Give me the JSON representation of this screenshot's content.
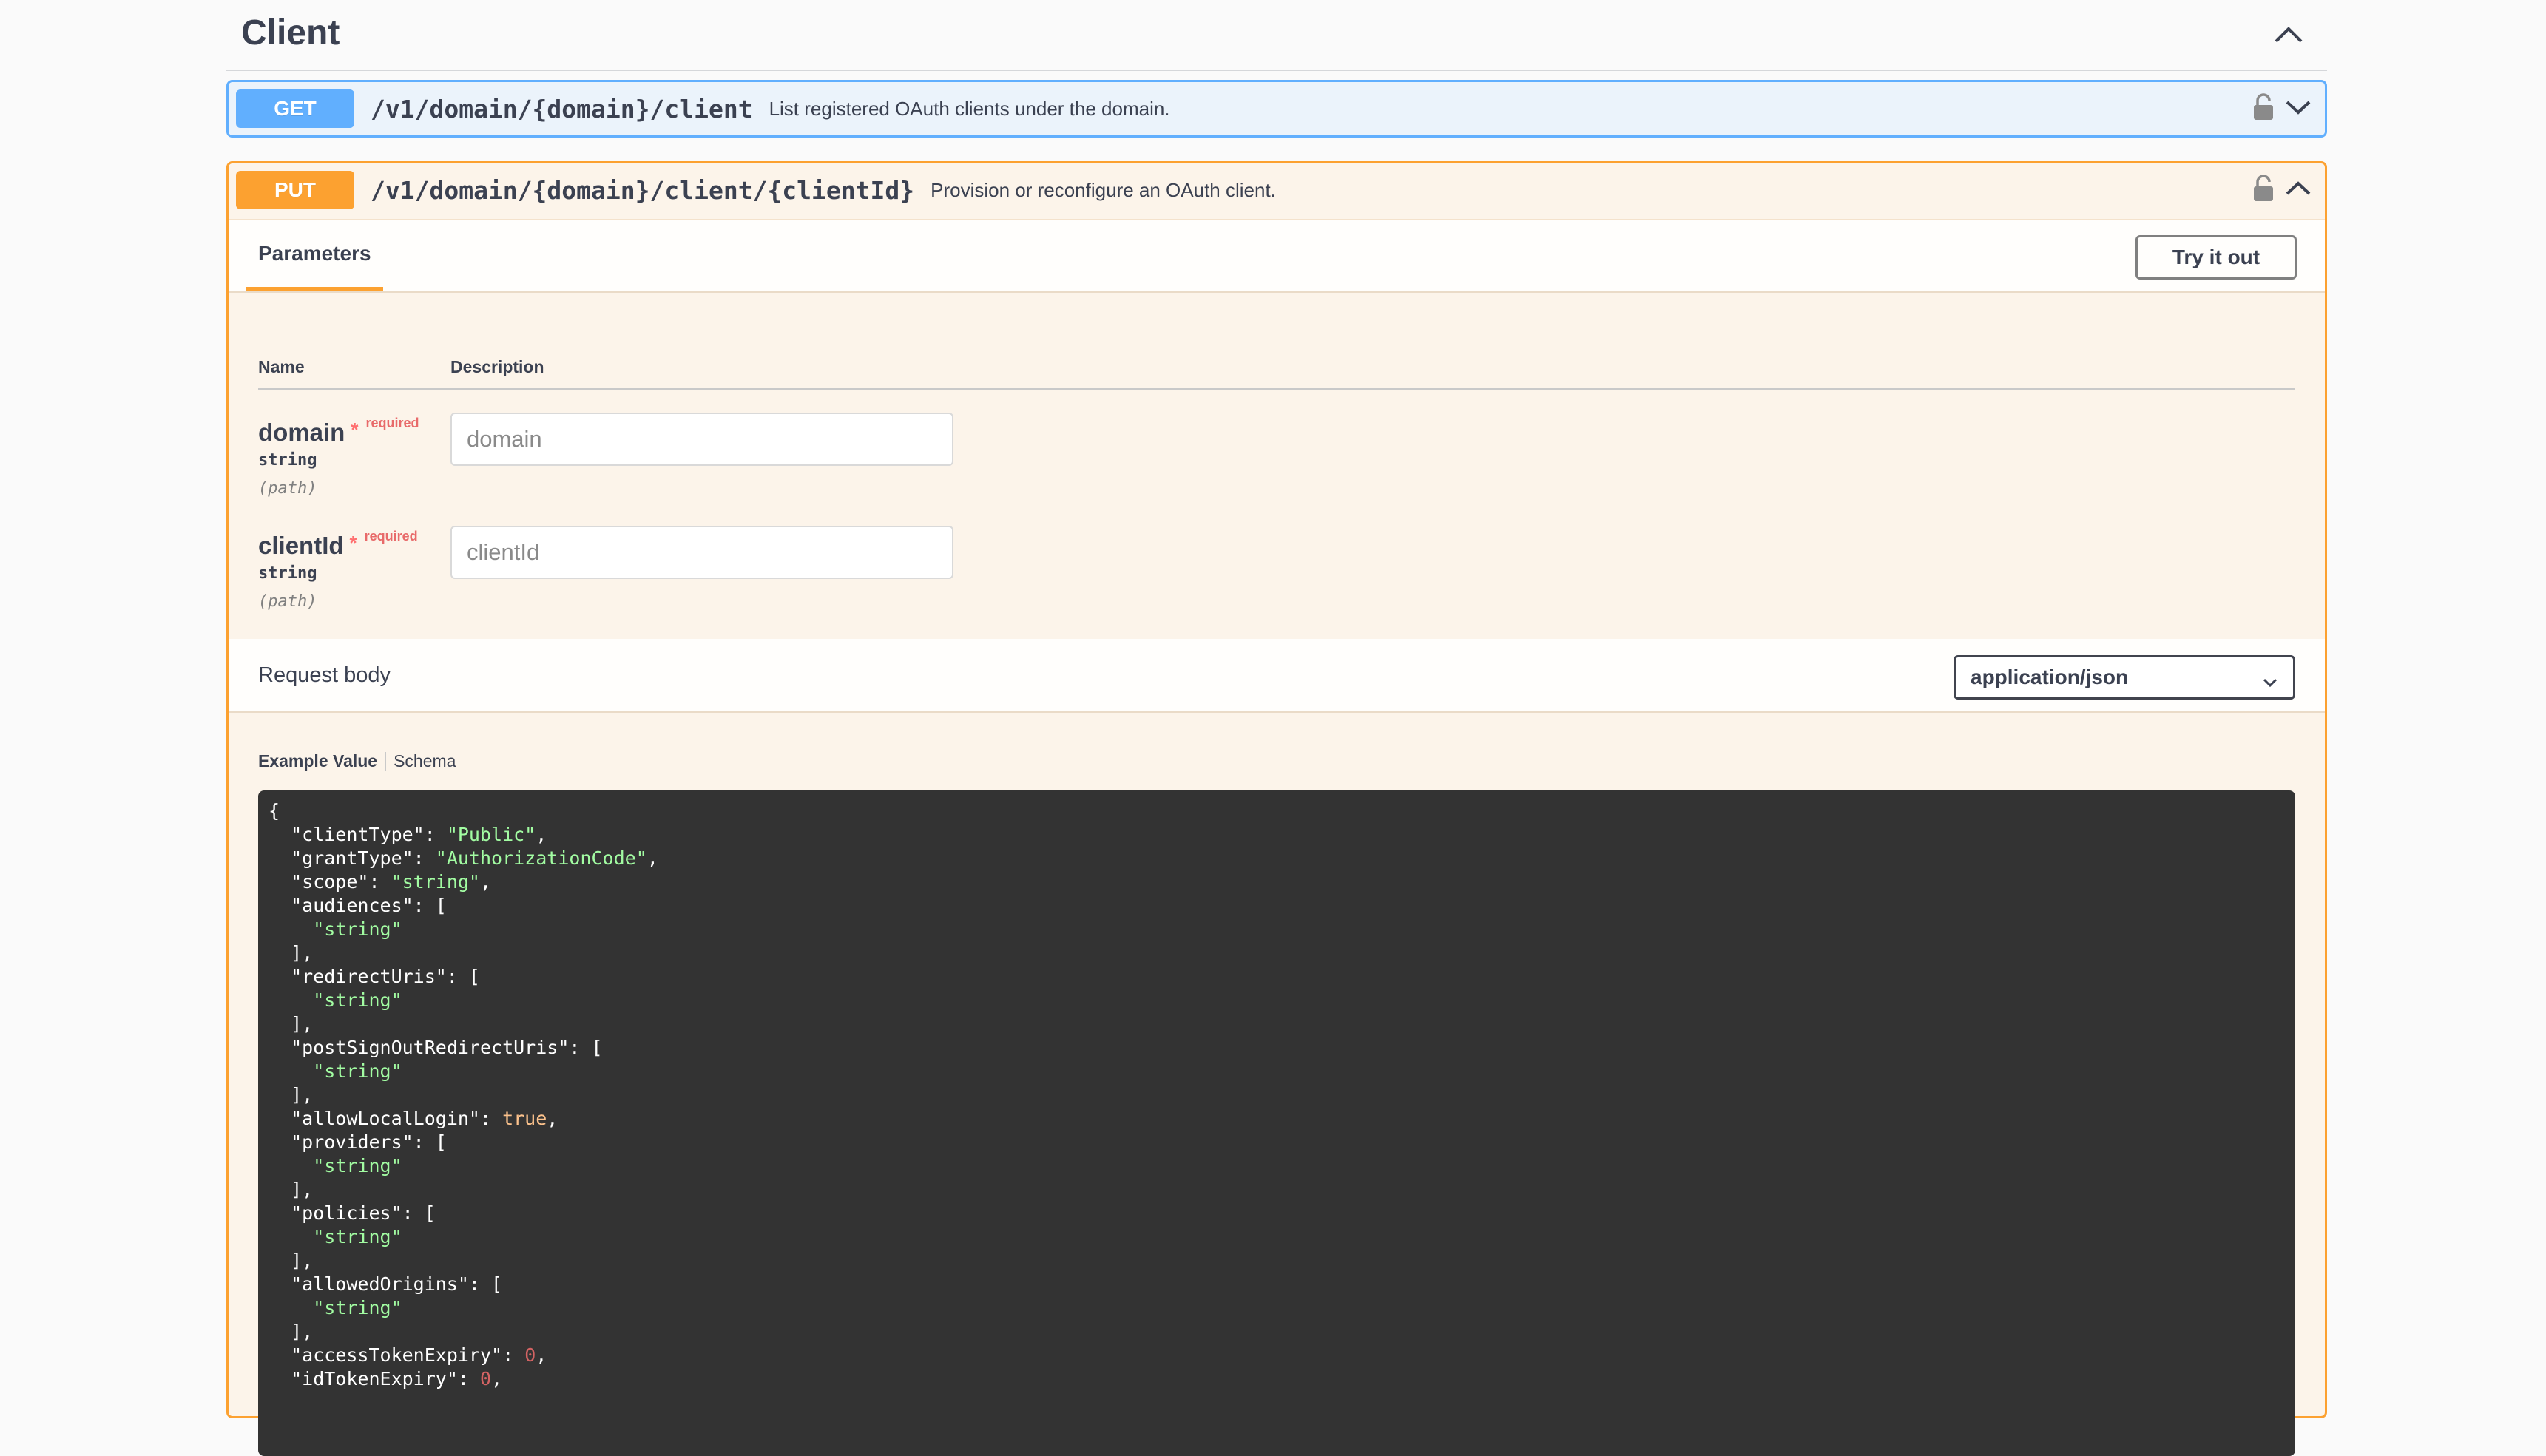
{
  "section": {
    "title": "Client"
  },
  "get_op": {
    "method": "GET",
    "path": "/v1/domain/{domain}/client",
    "description": "List registered OAuth clients under the domain."
  },
  "put_op": {
    "method": "PUT",
    "path": "/v1/domain/{domain}/client/{clientId}",
    "description": "Provision or reconfigure an OAuth client.",
    "tab_parameters": "Parameters",
    "try_button": "Try it out",
    "columns": {
      "name": "Name",
      "description": "Description"
    },
    "params": [
      {
        "name": "domain",
        "star": "*",
        "required": "required",
        "type": "string",
        "in": "(path)",
        "placeholder": "domain"
      },
      {
        "name": "clientId",
        "star": "*",
        "required": "required",
        "type": "string",
        "in": "(path)",
        "placeholder": "clientId"
      }
    ],
    "request_body_label": "Request body",
    "content_type": "application/json",
    "example_tab": "Example Value",
    "schema_tab": "Schema",
    "example_lines": [
      [
        [
          "p",
          "{"
        ]
      ],
      [
        [
          "p",
          "  \"clientType\": "
        ],
        [
          "s",
          "\"Public\""
        ],
        [
          "p",
          ","
        ]
      ],
      [
        [
          "p",
          "  \"grantType\": "
        ],
        [
          "s",
          "\"AuthorizationCode\""
        ],
        [
          "p",
          ","
        ]
      ],
      [
        [
          "p",
          "  \"scope\": "
        ],
        [
          "s",
          "\"string\""
        ],
        [
          "p",
          ","
        ]
      ],
      [
        [
          "p",
          "  \"audiences\": ["
        ]
      ],
      [
        [
          "p",
          "    "
        ],
        [
          "s",
          "\"string\""
        ]
      ],
      [
        [
          "p",
          "  ],"
        ]
      ],
      [
        [
          "p",
          "  \"redirectUris\": ["
        ]
      ],
      [
        [
          "p",
          "    "
        ],
        [
          "s",
          "\"string\""
        ]
      ],
      [
        [
          "p",
          "  ],"
        ]
      ],
      [
        [
          "p",
          "  \"postSignOutRedirectUris\": ["
        ]
      ],
      [
        [
          "p",
          "    "
        ],
        [
          "s",
          "\"string\""
        ]
      ],
      [
        [
          "p",
          "  ],"
        ]
      ],
      [
        [
          "p",
          "  \"allowLocalLogin\": "
        ],
        [
          "b",
          "true"
        ],
        [
          "p",
          ","
        ]
      ],
      [
        [
          "p",
          "  \"providers\": ["
        ]
      ],
      [
        [
          "p",
          "    "
        ],
        [
          "s",
          "\"string\""
        ]
      ],
      [
        [
          "p",
          "  ],"
        ]
      ],
      [
        [
          "p",
          "  \"policies\": ["
        ]
      ],
      [
        [
          "p",
          "    "
        ],
        [
          "s",
          "\"string\""
        ]
      ],
      [
        [
          "p",
          "  ],"
        ]
      ],
      [
        [
          "p",
          "  \"allowedOrigins\": ["
        ]
      ],
      [
        [
          "p",
          "    "
        ],
        [
          "s",
          "\"string\""
        ]
      ],
      [
        [
          "p",
          "  ],"
        ]
      ],
      [
        [
          "p",
          "  \"accessTokenExpiry\": "
        ],
        [
          "n",
          "0"
        ],
        [
          "p",
          ","
        ]
      ],
      [
        [
          "p",
          "  \"idTokenExpiry\": "
        ],
        [
          "n",
          "0"
        ],
        [
          "p",
          ","
        ]
      ]
    ]
  },
  "colors": {
    "get": "#61affe",
    "put": "#fca130",
    "code_bg": "#333333",
    "code_string": "#a2fca2"
  },
  "icons": {
    "section_toggle": "chevron-up-icon",
    "lock": "lock-icon",
    "get_toggle": "chevron-down-icon",
    "put_toggle": "chevron-up-icon",
    "select_arrow": "chevron-down-icon"
  }
}
